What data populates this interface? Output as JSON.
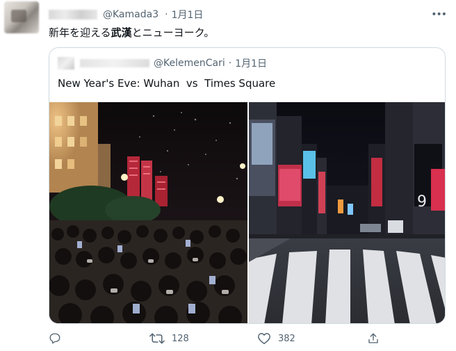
{
  "tweet": {
    "handle": "@Kamada3",
    "separator": "·",
    "date": "1月1日",
    "more_label": "•••",
    "text_prefix": "新年を迎える",
    "text_bold": "武漢",
    "text_suffix": "とニューヨーク。"
  },
  "quoted_tweet": {
    "handle": "@KelemenCari",
    "separator": "·",
    "date": "1月1日",
    "text": "New Year's Eve: Wuhan  vs  Times Square"
  },
  "media": {
    "left_description_icon": "wuhan-crowd-photo",
    "right_description_icon": "times-square-photo"
  },
  "actions": {
    "reply_icon": "reply-icon",
    "retweet_icon": "retweet-icon",
    "retweet_count": "128",
    "like_icon": "like-icon",
    "like_count": "382",
    "share_icon": "share-icon"
  },
  "colors": {
    "text_primary": "#0f1419",
    "text_secondary": "#536471",
    "border": "#cfd9de"
  }
}
